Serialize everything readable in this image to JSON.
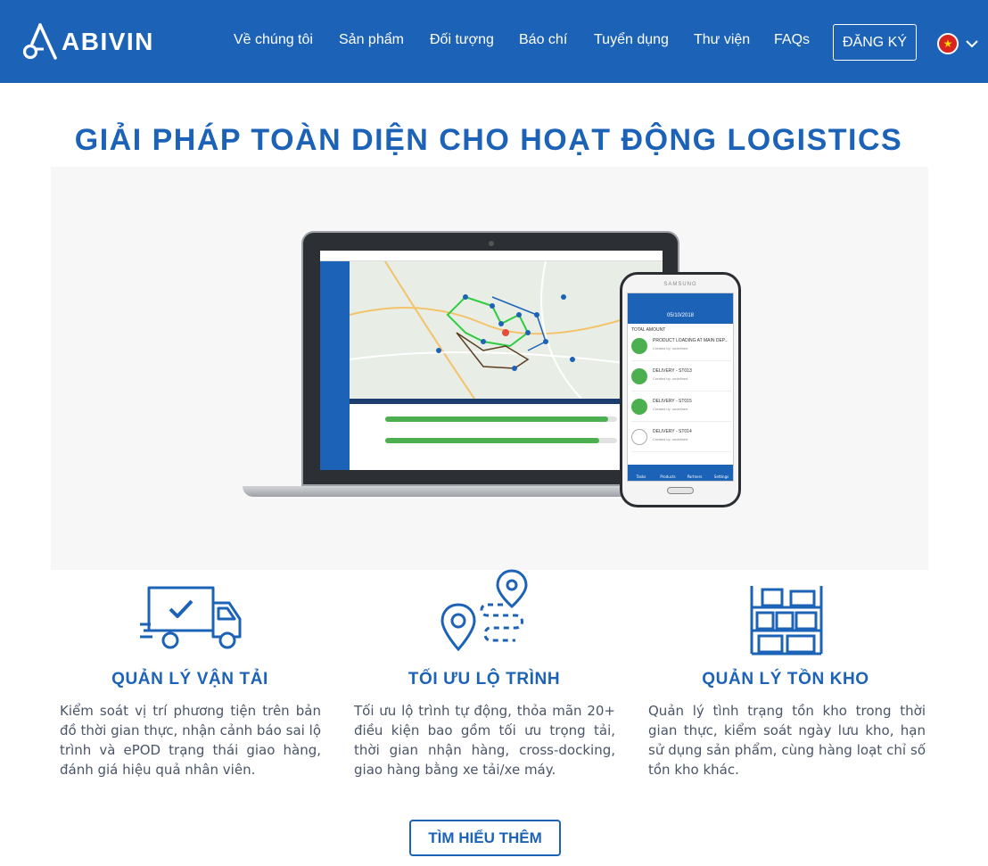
{
  "brand": {
    "name": "ABIVIN"
  },
  "nav": {
    "items": [
      {
        "label": "Về chúng tôi"
      },
      {
        "label": "Sản phẩm"
      },
      {
        "label": "Đối tượng"
      },
      {
        "label": "Báo chí"
      },
      {
        "label": "Tuyển dụng"
      },
      {
        "label": "Thư viện"
      },
      {
        "label": "FAQs"
      }
    ],
    "signup_label": "ĐĂNG KÝ",
    "language_flag": "vietnam-flag-icon"
  },
  "hero": {
    "title": "GIẢI PHÁP TOÀN DIỆN CHO HOẠT ĐỘNG LOGISTICS",
    "phone": {
      "brand": "SAMSUNG",
      "date": "05/10/2018",
      "total_label": "TOTAL AMOUNT",
      "items": [
        {
          "title": "PRODUCT LOADING AT MAIN DEP...",
          "sub": "Created by: undefined"
        },
        {
          "title": "DELIVERY - ST013",
          "sub": "Created by: undefined"
        },
        {
          "title": "DELIVERY - ST015",
          "sub": "Created by: undefined"
        },
        {
          "title": "DELIVERY - ST014",
          "sub": "Created by: undefined"
        }
      ],
      "tabs": [
        "Tasks",
        "Products",
        "Partners",
        "Settings"
      ]
    }
  },
  "features": [
    {
      "icon": "truck-check-icon",
      "title": "QUẢN LÝ VẬN TẢI",
      "description": "Kiểm soát vị trí phương tiện trên bản đồ thời gian thực, nhận cảnh báo sai lộ trình và ePOD trạng thái giao hàng, đánh giá hiệu quả nhân viên."
    },
    {
      "icon": "route-pin-icon",
      "title": "TỐI ƯU LỘ TRÌNH",
      "description": "Tối ưu lộ trình tự động, thỏa mãn 20+ điều kiện bao gồm tối ưu trọng tải, thời gian nhận hàng, cross-docking, giao hàng bằng xe tải/xe máy."
    },
    {
      "icon": "warehouse-shelf-icon",
      "title": "QUẢN LÝ TỒN KHO",
      "description": "Quản lý tình trạng tồn kho trong thời gian thực, kiểm soát ngày lưu kho, hạn sử dụng sản phẩm, cùng hàng loạt chỉ số tồn kho khác."
    }
  ],
  "cta": {
    "label": "TÌM HIỂU THÊM"
  },
  "colors": {
    "primary": "#1c63b8",
    "text": "#4a5568"
  }
}
